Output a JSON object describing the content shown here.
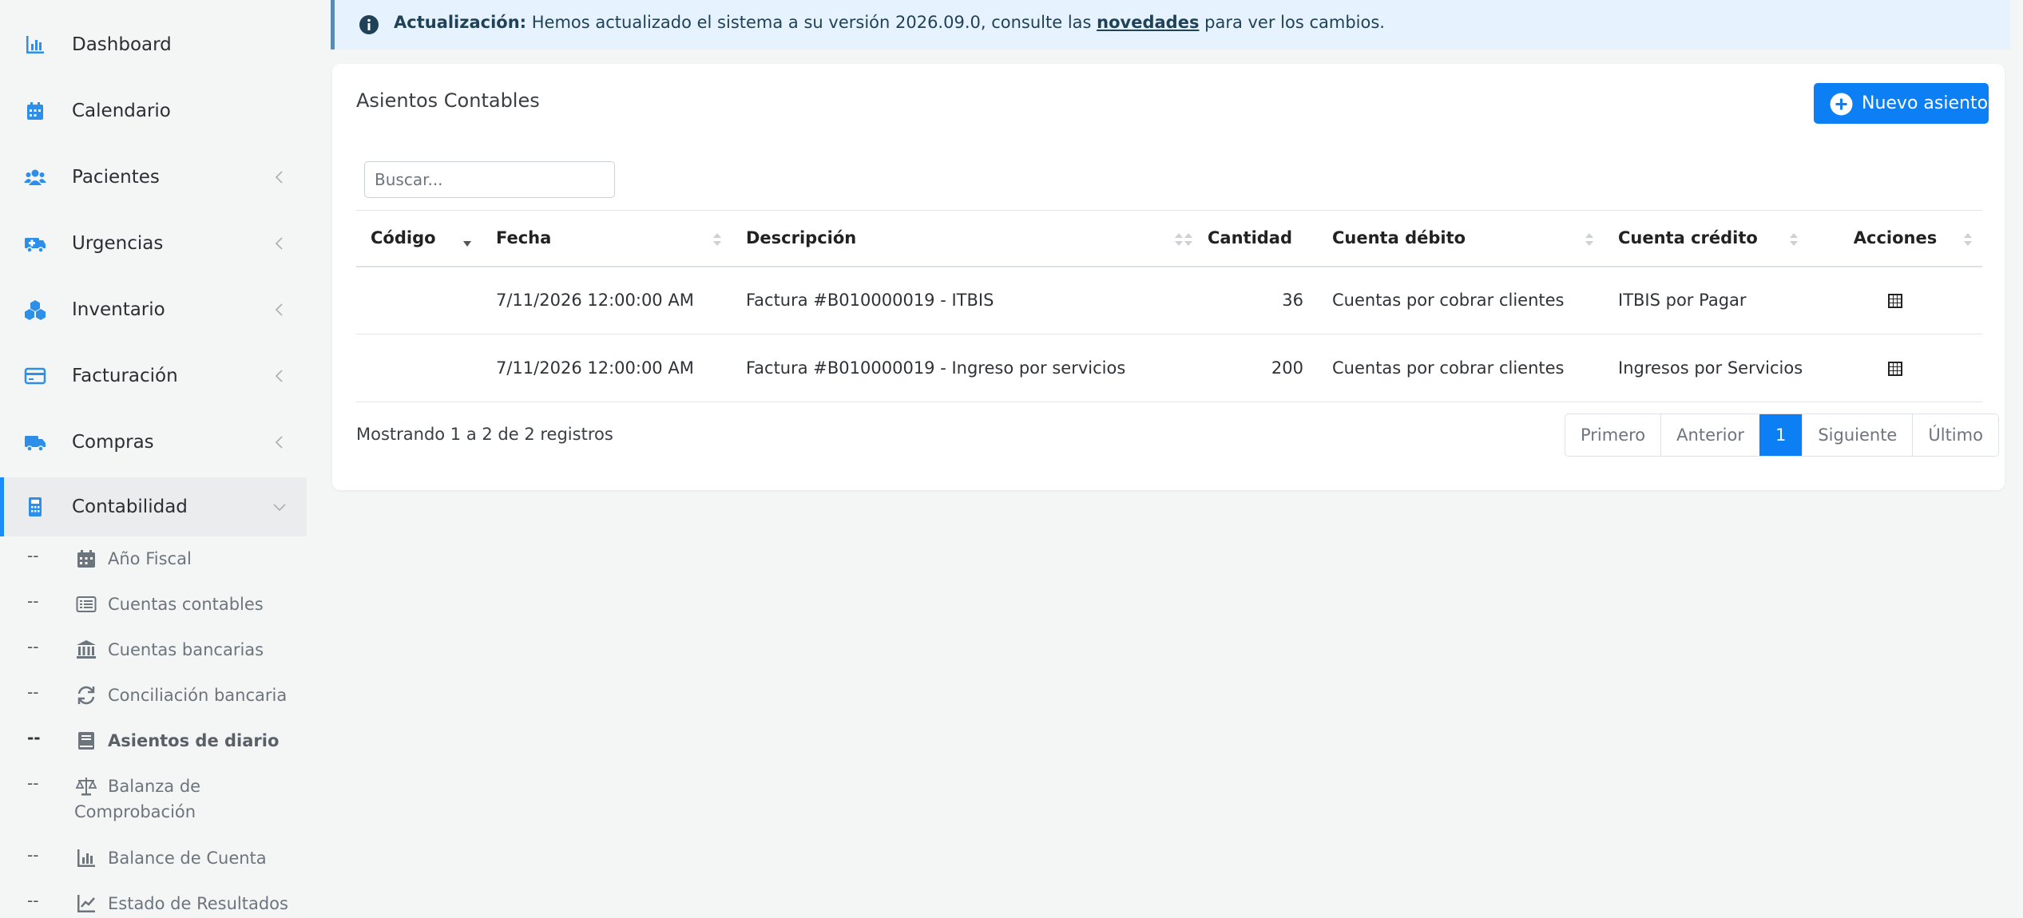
{
  "sidebar": {
    "items": [
      {
        "label": "Dashboard",
        "icon": "chart-bar-icon"
      },
      {
        "label": "Calendario",
        "icon": "calendar-icon"
      },
      {
        "label": "Pacientes",
        "icon": "users-icon"
      },
      {
        "label": "Urgencias",
        "icon": "ambulance-icon"
      },
      {
        "label": "Inventario",
        "icon": "boxes-icon"
      },
      {
        "label": "Facturación",
        "icon": "credit-card-icon"
      },
      {
        "label": "Compras",
        "icon": "truck-icon"
      },
      {
        "label": "Contabilidad",
        "icon": "calculator-icon"
      }
    ],
    "subitems": [
      {
        "dash": "--",
        "label": "Año Fiscal",
        "icon": "calendar-icon"
      },
      {
        "dash": "--",
        "label": "Cuentas contables",
        "icon": "list-icon"
      },
      {
        "dash": "--",
        "label": "Cuentas bancarias",
        "icon": "bank-icon"
      },
      {
        "dash": "--",
        "label": "Conciliación bancaria",
        "icon": "sync-icon"
      },
      {
        "dash": "--",
        "label": "Asientos de diario",
        "icon": "book-icon"
      },
      {
        "dash": "--",
        "label_line1": "Balanza de",
        "label_line2": "Comprobación",
        "icon": "scale-icon"
      },
      {
        "dash": "--",
        "label": "Balance de Cuenta",
        "icon": "chart-bar-icon"
      },
      {
        "dash": "--",
        "label": "Estado de Resultados",
        "icon": "chart-line-icon"
      }
    ]
  },
  "alert": {
    "strong": "Actualización:",
    "text_before": " Hemos actualizado el sistema a su versión 2026.09.0, consulte las ",
    "link": "novedades",
    "text_after": " para ver los cambios."
  },
  "card": {
    "title": "Asientos Contables",
    "new_button": "Nuevo asiento"
  },
  "search": {
    "placeholder": "Buscar..."
  },
  "table": {
    "headers": [
      "Código",
      "Fecha",
      "Descripción",
      "Cantidad",
      "Cuenta débito",
      "Cuenta crédito",
      "Acciones"
    ],
    "rows": [
      {
        "codigo": "",
        "fecha": "7/11/2026 12:00:00 AM",
        "descripcion": "Factura #B010000019 - ITBIS",
        "cantidad": "36",
        "debito": "Cuentas por cobrar clientes",
        "credito": "ITBIS por Pagar"
      },
      {
        "codigo": "",
        "fecha": "7/11/2026 12:00:00 AM",
        "descripcion": "Factura #B010000019 - Ingreso por servicios",
        "cantidad": "200",
        "debito": "Cuentas por cobrar clientes",
        "credito": "Ingresos por Servicios"
      }
    ]
  },
  "footer": {
    "info": "Mostrando 1 a 2 de 2 registros",
    "pager": {
      "first": "Primero",
      "prev": "Anterior",
      "current": "1",
      "next": "Siguiente",
      "last": "Último"
    }
  },
  "colors": {
    "accent": "#0d7ff5",
    "icon_blue": "#2e8fe8"
  }
}
